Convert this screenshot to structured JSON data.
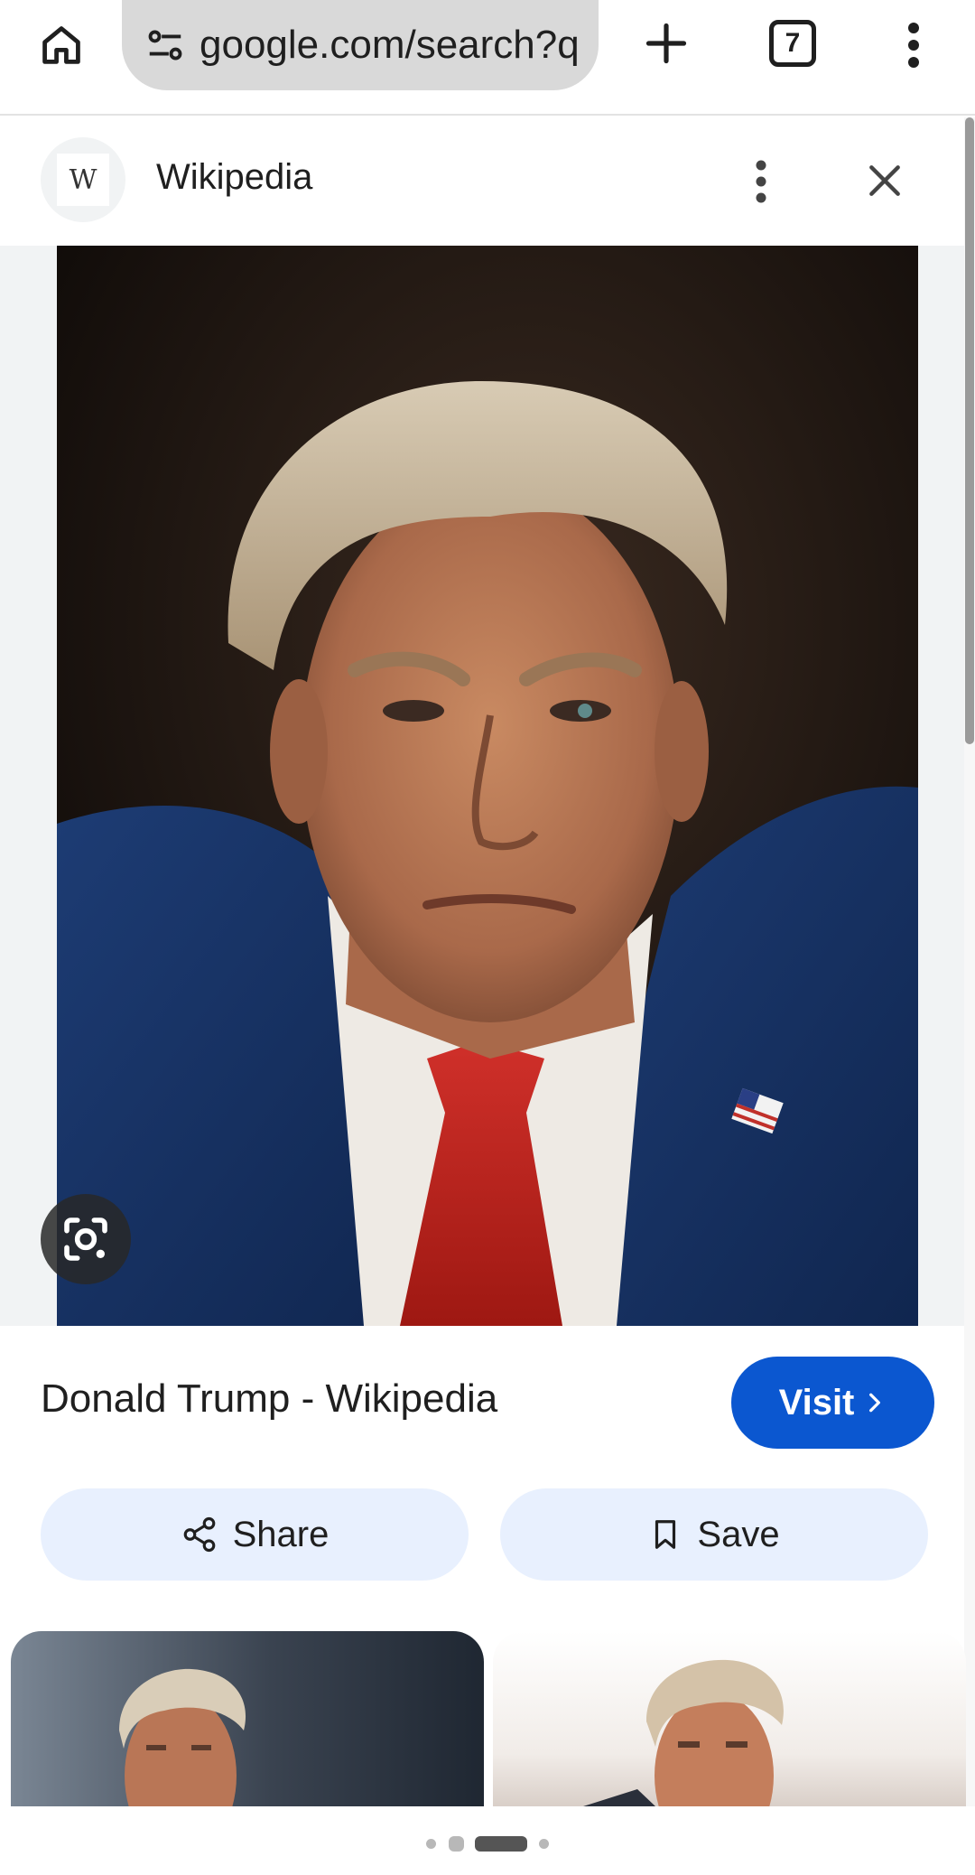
{
  "browser": {
    "url": "google.com/search?q",
    "tab_count": "7",
    "icons": {
      "home": "home-icon",
      "site_info": "tune-icon",
      "new_tab": "plus-icon",
      "menu": "more-vertical-icon"
    }
  },
  "source": {
    "avatar_letter": "W",
    "name": "Wikipedia",
    "icons": {
      "more": "more-vertical-icon",
      "close": "close-icon"
    }
  },
  "image": {
    "alt": "Donald Trump portrait",
    "lens_icon": "google-lens-icon"
  },
  "result": {
    "title": "Donald Trump - Wikipedia",
    "visit_label": "Visit"
  },
  "actions": {
    "share_label": "Share",
    "save_label": "Save"
  },
  "colors": {
    "accent": "#0b57d0",
    "action_bg": "#e8f0fe",
    "urlbar_bg": "#d9d9d9"
  },
  "pagination": {
    "total": 4,
    "active": 2
  }
}
